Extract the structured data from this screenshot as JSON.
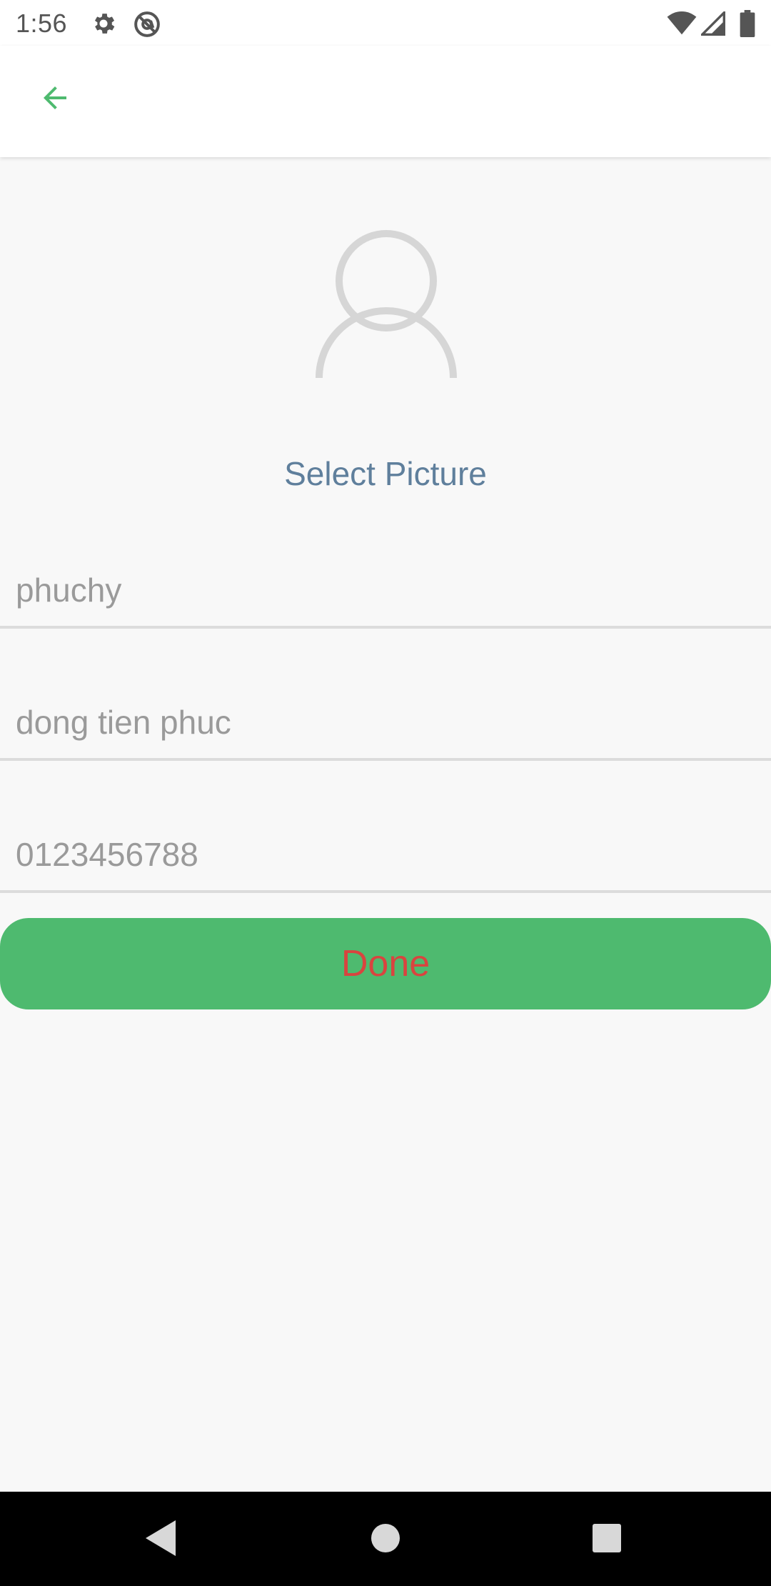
{
  "status_bar": {
    "time": "1:56",
    "icons": [
      "settings-gear-icon",
      "at-sign-icon",
      "wifi-icon",
      "cell-signal-icon",
      "battery-icon"
    ]
  },
  "app_bar": {
    "back_icon": "arrow-left-icon",
    "accent_color": "#4eba6f"
  },
  "profile": {
    "avatar_icon": "person-outline-icon",
    "select_picture_label": "Select Picture"
  },
  "form": {
    "username": {
      "value": "",
      "placeholder": "phuchy"
    },
    "full_name": {
      "value": "",
      "placeholder": "dong tien phuc"
    },
    "phone": {
      "value": "",
      "placeholder": "0123456788"
    }
  },
  "done_button": {
    "label": "Done",
    "background": "#4eba6f",
    "text_color": "#d9443f"
  },
  "nav_bar": {
    "icons": [
      "back-triangle-icon",
      "home-circle-icon",
      "recents-square-icon"
    ]
  }
}
